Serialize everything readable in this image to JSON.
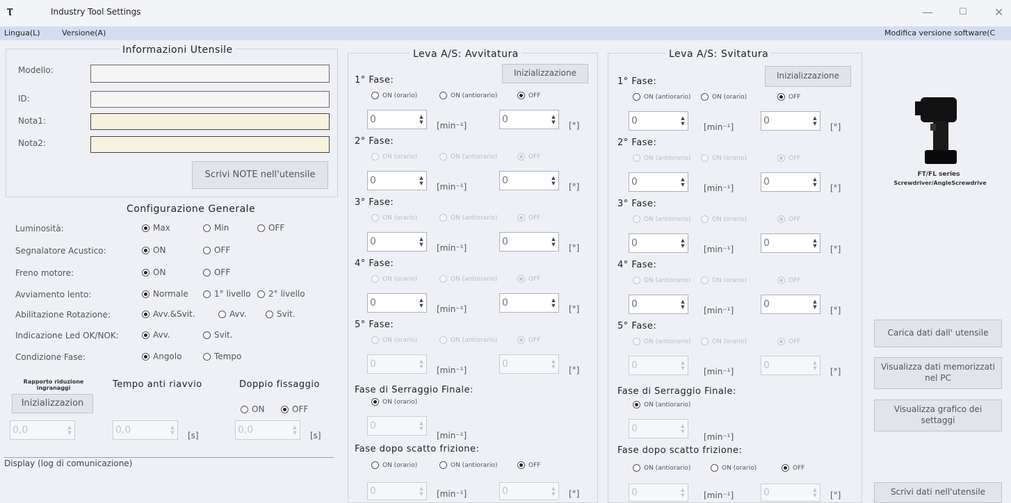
{
  "window": {
    "title": "Industry Tool Settings",
    "icon": "screwdriver-icon",
    "minimize": "—",
    "maximize": "☐",
    "close": "✕"
  },
  "menu": {
    "language": "Lingua(L)",
    "version": "Versione(A)",
    "modify_software": "Modifica versione software(C"
  },
  "tool_info": {
    "title": "Informazioni Utensile",
    "model_label": "Modello:",
    "model_value": "",
    "id_label": "ID:",
    "id_value": "",
    "note1_label": "Nota1:",
    "note1_value": "",
    "note2_label": "Nota2:",
    "note2_value": "",
    "write_notes_button": "Scrivi NOTE nell'utensile"
  },
  "general": {
    "title": "Configurazione Generale",
    "rows": [
      {
        "label": "Luminosità:",
        "options": [
          "Max",
          "Min",
          "OFF"
        ],
        "selected": 0
      },
      {
        "label": "Segnalatore Acustico:",
        "options": [
          "ON",
          "OFF"
        ],
        "selected": 0
      },
      {
        "label": "Freno motore:",
        "options": [
          "ON",
          "OFF"
        ],
        "selected": 0
      },
      {
        "label": "Avviamento lento:",
        "options": [
          "Normale",
          "1° livello",
          "2° livello"
        ],
        "selected": 0
      },
      {
        "label": "Abilitazione Rotazione:",
        "options": [
          "Avv.&Svit.",
          "Avv.",
          "Svit."
        ],
        "selected": 0
      },
      {
        "label": "Indicazione Led OK/NOK:",
        "options": [
          "Avv.",
          "Svit."
        ],
        "selected": 0
      },
      {
        "label": "Condizione Fase:",
        "options": [
          "Angolo",
          "Tempo"
        ],
        "selected": 0
      }
    ]
  },
  "bottom_left": {
    "gear_ratio_label": "Rapporto riduzione ingranaggi",
    "init_button": "Inizializzazion",
    "gear_value": "0,0",
    "anti_restart_label": "Tempo anti riavvio",
    "anti_restart_value": "0,0",
    "anti_restart_unit": "[s]",
    "double_fix_label": "Doppio fissaggio",
    "double_fix_options": [
      "ON",
      "OFF"
    ],
    "double_fix_selected": 1,
    "double_fix_value": "0,0",
    "double_fix_unit": "[s]"
  },
  "display_log": "Display (log di comunicazione)",
  "screw_in": {
    "title": "Leva A/S: Avvitatura",
    "init_button": "Inizializzazione",
    "phases": [
      "1° Fase:",
      "2° Fase:",
      "3° Fase:",
      "4° Fase:",
      "5° Fase:"
    ],
    "phase_options": [
      "ON (orario)",
      "ON (antiorario)",
      "OFF"
    ],
    "final_label": "Fase di Serraggio Finale:",
    "final_option": "ON (orario)",
    "after_clutch_label": "Fase dopo scatto frizione:",
    "after_clutch_options": [
      "ON (orario)",
      "ON (antiorario)",
      "OFF"
    ]
  },
  "screw_out": {
    "title": "Leva A/S: Svitatura",
    "init_button": "Inizializzazione",
    "phases": [
      "1° Fase:",
      "2° Fase:",
      "3° Fase:",
      "4° Fase:",
      "5° Fase:"
    ],
    "phase_options": [
      "ON (antiorario)",
      "ON (orario)",
      "OFF"
    ],
    "final_label": "Fase di Serraggio Finale:",
    "final_option": "ON (antiorario)",
    "after_clutch_label": "Fase dopo scatto frizione:",
    "after_clutch_options": [
      "ON (antiorario)",
      "ON (orario)",
      "OFF"
    ]
  },
  "units": {
    "speed": "[min⁻¹]",
    "angle": "[°]"
  },
  "spin_value": "0",
  "right": {
    "product_line1": "FT/FL series",
    "product_line2": "Screwdriver/AngleScrewdrive",
    "load_button": "Carica dati dall' utensile",
    "view_pc_button": "Visualizza dati memorizzati nel PC",
    "view_graph_button": "Visualizza grafico dei settaggi",
    "write_button": "Scrivi dati nell'utensile"
  }
}
